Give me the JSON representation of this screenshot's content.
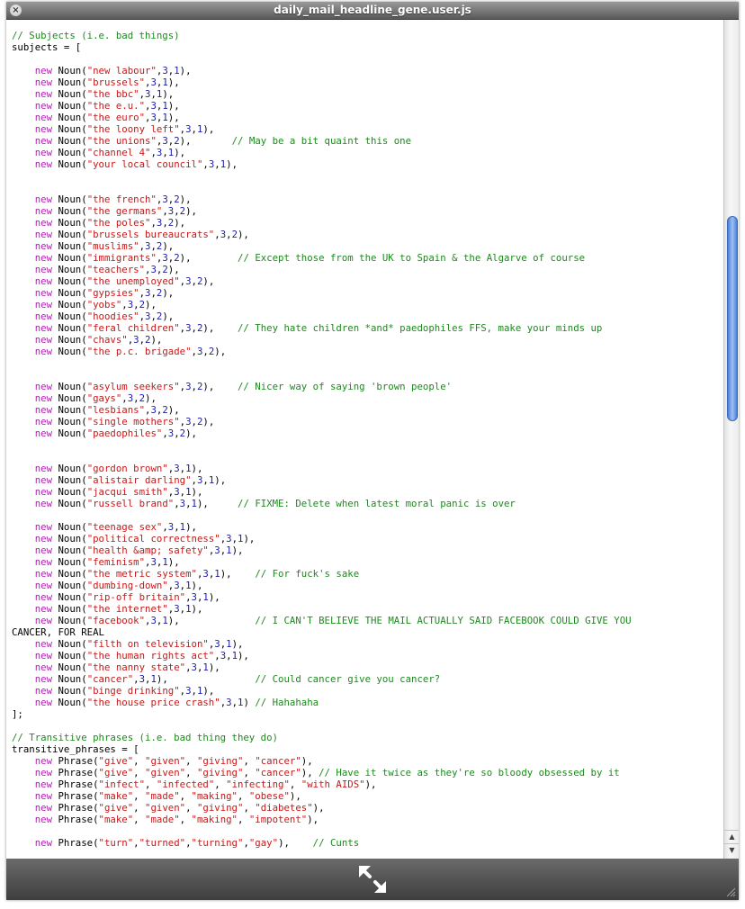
{
  "window": {
    "title": "daily_mail_headline_gene.user.js",
    "close_glyph": "×"
  },
  "icons": {
    "close": "close-icon",
    "expand": "expand-arrows-icon",
    "resize": "resize-grip-icon",
    "scroll_up": "chevron-up-icon",
    "scroll_down": "chevron-down-icon"
  },
  "scrollbar": {
    "up_glyph": "▲",
    "down_glyph": "▼",
    "position_fraction": 0.21
  },
  "colors": {
    "comment": "#1d8a1d",
    "keyword": "#b01fb0",
    "string": "#c41a1a",
    "number": "#1a1aa6"
  },
  "code_lines": [
    "// Subjects (i.e. bad things)",
    "subjects = [",
    "",
    "    new Noun(\"new labour\",3,1),",
    "    new Noun(\"brussels\",3,1),",
    "    new Noun(\"the bbc\",3,1),",
    "    new Noun(\"the e.u.\",3,1),",
    "    new Noun(\"the euro\",3,1),",
    "    new Noun(\"the loony left\",3,1),",
    "    new Noun(\"the unions\",3,2),       // May be a bit quaint this one",
    "    new Noun(\"channel 4\",3,1),",
    "    new Noun(\"your local council\",3,1),",
    "",
    "",
    "    new Noun(\"the french\",3,2),",
    "    new Noun(\"the germans\",3,2),",
    "    new Noun(\"the poles\",3,2),",
    "    new Noun(\"brussels bureaucrats\",3,2),",
    "    new Noun(\"muslims\",3,2),",
    "    new Noun(\"immigrants\",3,2),        // Except those from the UK to Spain & the Algarve of course",
    "    new Noun(\"teachers\",3,2),",
    "    new Noun(\"the unemployed\",3,2),",
    "    new Noun(\"gypsies\",3,2),",
    "    new Noun(\"yobs\",3,2),",
    "    new Noun(\"hoodies\",3,2),",
    "    new Noun(\"feral children\",3,2),    // They hate children *and* paedophiles FFS, make your minds up",
    "    new Noun(\"chavs\",3,2),",
    "    new Noun(\"the p.c. brigade\",3,2),",
    "",
    "",
    "    new Noun(\"asylum seekers\",3,2),    // Nicer way of saying 'brown people'",
    "    new Noun(\"gays\",3,2),",
    "    new Noun(\"lesbians\",3,2),",
    "    new Noun(\"single mothers\",3,2),",
    "    new Noun(\"paedophiles\",3,2),",
    "",
    "",
    "    new Noun(\"gordon brown\",3,1),",
    "    new Noun(\"alistair darling\",3,1),",
    "    new Noun(\"jacqui smith\",3,1),",
    "    new Noun(\"russell brand\",3,1),     // FIXME: Delete when latest moral panic is over",
    "",
    "    new Noun(\"teenage sex\",3,1),",
    "    new Noun(\"political correctness\",3,1),",
    "    new Noun(\"health &amp; safety\",3,1),",
    "    new Noun(\"feminism\",3,1),",
    "    new Noun(\"the metric system\",3,1),    // For fuck's sake",
    "    new Noun(\"dumbing-down\",3,1),",
    "    new Noun(\"rip-off britain\",3,1),",
    "    new Noun(\"the internet\",3,1),",
    "    new Noun(\"facebook\",3,1),             // I CAN'T BELIEVE THE MAIL ACTUALLY SAID FACEBOOK COULD GIVE YOU",
    "CANCER, FOR REAL",
    "    new Noun(\"filth on television\",3,1),",
    "    new Noun(\"the human rights act\",3,1),",
    "    new Noun(\"the nanny state\",3,1),",
    "    new Noun(\"cancer\",3,1),               // Could cancer give you cancer?",
    "    new Noun(\"binge drinking\",3,1),",
    "    new Noun(\"the house price crash\",3,1) // Hahahaha",
    "];",
    "",
    "// Transitive phrases (i.e. bad thing they do)",
    "transitive_phrases = [",
    "    new Phrase(\"give\", \"given\", \"giving\", \"cancer\"),",
    "    new Phrase(\"give\", \"given\", \"giving\", \"cancer\"), // Have it twice as they're so bloody obsessed by it",
    "    new Phrase(\"infect\", \"infected\", \"infecting\", \"with AIDS\"),",
    "    new Phrase(\"make\", \"made\", \"making\", \"obese\"),",
    "    new Phrase(\"give\", \"given\", \"giving\", \"diabetes\"),",
    "    new Phrase(\"make\", \"made\", \"making\", \"impotent\"),",
    "",
    "    new Phrase(\"turn\",\"turned\",\"turning\",\"gay\"),    // Cunts"
  ]
}
